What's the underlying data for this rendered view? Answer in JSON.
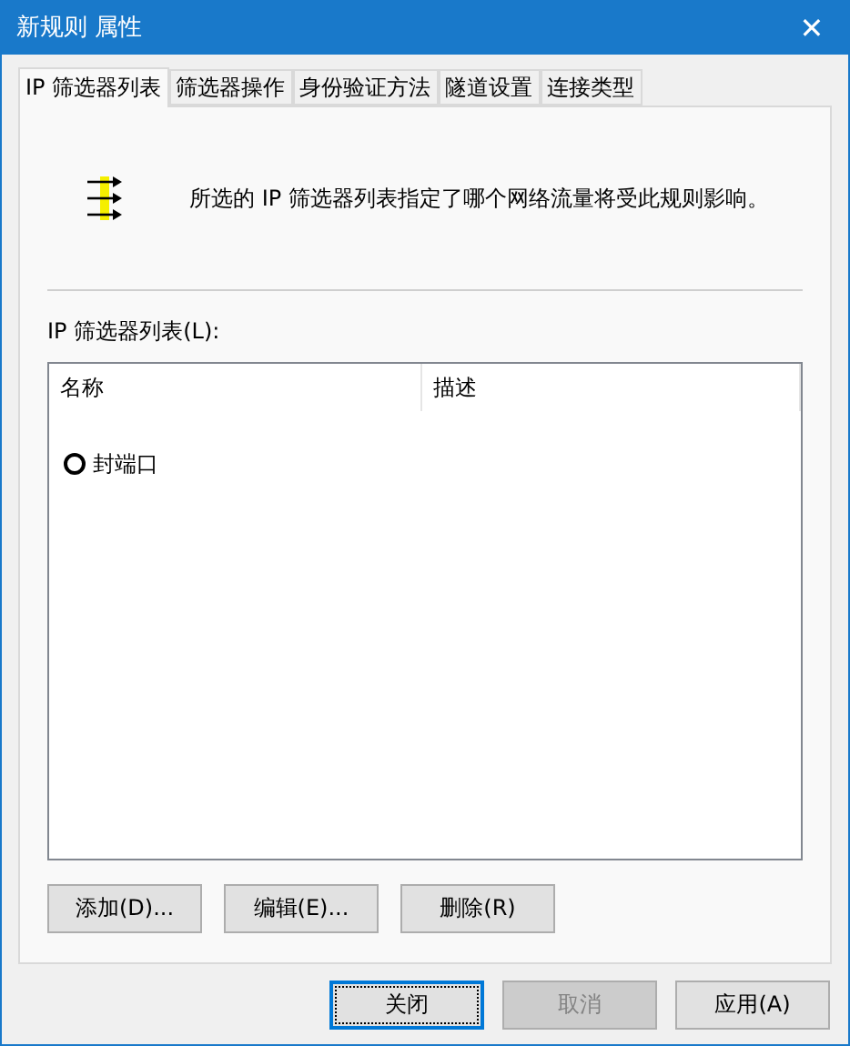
{
  "window": {
    "title": "新规则 属性",
    "close": "✕"
  },
  "tabs": [
    {
      "label": "IP 筛选器列表",
      "selected": true
    },
    {
      "label": "筛选器操作",
      "selected": false
    },
    {
      "label": "身份验证方法",
      "selected": false
    },
    {
      "label": "隧道设置",
      "selected": false
    },
    {
      "label": "连接类型",
      "selected": false
    }
  ],
  "description": "所选的 IP 筛选器列表指定了哪个网络流量将受此规则影响。",
  "list": {
    "label": "IP 筛选器列表(L):",
    "columns": [
      "名称",
      "描述"
    ],
    "rows": [
      {
        "name": "封端口",
        "description": "",
        "selected": false
      }
    ]
  },
  "list_buttons": [
    "添加(D)...",
    "编辑(E)...",
    "删除(R)"
  ],
  "dialog_buttons": [
    {
      "label": "关闭",
      "default": true,
      "disabled": false
    },
    {
      "label": "取消",
      "default": false,
      "disabled": true
    },
    {
      "label": "应用(A)",
      "default": false,
      "disabled": false
    }
  ]
}
